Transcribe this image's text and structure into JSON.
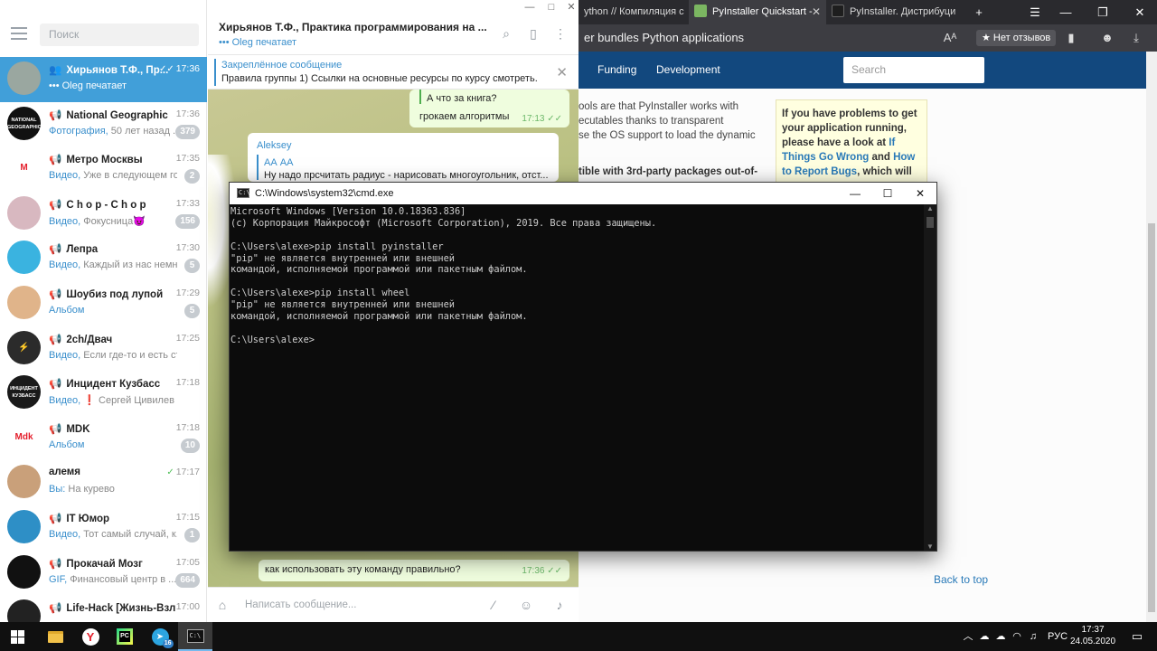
{
  "browser": {
    "tabs": [
      {
        "label": "ython // Компиляция с",
        "fav_color": "#888888"
      },
      {
        "label": "PyInstaller Quickstart - ",
        "fav_color": "#7bb661"
      },
      {
        "label": "PyInstaller. Дистрибуци",
        "fav_color": "#1e1e1e"
      }
    ],
    "new_tab": "+",
    "page_title": "er bundles Python applications",
    "reviews_label": "★ Нет отзывов",
    "nav": [
      "Funding",
      "Development"
    ],
    "search_placeholder": "Search",
    "doc_paragraph": "ools are that PyInstaller works with\necutables thanks to transparent\nse the OS support to load the dynamic",
    "doc_bold": "tible with 3rd-party packages out-of-",
    "note_text_1": "If you have problems to get your application running, please have a look at ",
    "note_link_1": "If Things Go Wrong",
    "note_text_2": " and ",
    "note_link_2": "How to Report Bugs",
    "note_text_3": ", which will",
    "back_to_top": "Back to top"
  },
  "telegram": {
    "search_placeholder": "Поиск",
    "chats": [
      {
        "name": "Хирьянов Т.Ф., Пр...",
        "type": "group",
        "time": "17:36",
        "check": "✓✓",
        "preview_kind": "",
        "preview": "••• Oleg печатает",
        "badge": "",
        "avatar_text": "",
        "avatar_color": "#9aa7a0",
        "active": true
      },
      {
        "name": "National Geographic",
        "type": "channel",
        "time": "17:36",
        "check": "",
        "preview_kind": "Фотография,",
        "preview": " 50 лет назад ...",
        "badge": "379",
        "avatar_text": "NATIONAL GEOGRAPHIC",
        "avatar_color": "#111111",
        "active": false
      },
      {
        "name": "Метро Москвы",
        "type": "channel",
        "time": "17:35",
        "check": "",
        "preview_kind": "Видео,",
        "preview": " Уже в следующем го...",
        "badge": "2",
        "avatar_text": "M",
        "avatar_color": "#ffffff",
        "active": false
      },
      {
        "name": "C h o p - C h o p",
        "type": "channel",
        "time": "17:33",
        "check": "",
        "preview_kind": "Видео,",
        "preview": " Фокусница😈",
        "badge": "156",
        "avatar_text": "",
        "avatar_color": "#d8b8c0",
        "active": false
      },
      {
        "name": "Лепра",
        "type": "channel",
        "time": "17:30",
        "check": "",
        "preview_kind": "Видео,",
        "preview": " Каждый из нас немн...",
        "badge": "5",
        "avatar_text": "",
        "avatar_color": "#3ab3e0",
        "active": false
      },
      {
        "name": "Шоубиз под лупой",
        "type": "channel",
        "time": "17:29",
        "check": "",
        "preview_kind": "Альбом",
        "preview": "",
        "badge": "5",
        "avatar_text": "",
        "avatar_color": "#e0b48a",
        "active": false
      },
      {
        "name": "2ch/Двач",
        "type": "channel",
        "time": "17:25",
        "check": "",
        "preview_kind": "Видео,",
        "preview": " Если где-то и есть стабил...",
        "badge": "",
        "avatar_text": "⚡",
        "avatar_color": "#2b2b2b",
        "active": false
      },
      {
        "name": "Инцидент Кузбасс",
        "type": "channel",
        "time": "17:18",
        "check": "",
        "preview_kind": "Видео,",
        "preview": " ❗ Сергей Цивилев обра...",
        "badge": "",
        "avatar_text": "ИНЦИДЕНТ КУЗБАСС",
        "avatar_color": "#1a1a1a",
        "active": false
      },
      {
        "name": "MDK",
        "type": "channel",
        "time": "17:18",
        "check": "",
        "preview_kind": "Альбом",
        "preview": "",
        "badge": "10",
        "avatar_text": "Mdk",
        "avatar_color": "#ffffff",
        "active": false
      },
      {
        "name": "алемя",
        "type": "user",
        "time": "17:17",
        "check": "✓",
        "preview_kind": "Вы:",
        "preview": " На курево",
        "badge": "",
        "avatar_text": "",
        "avatar_color": "#c9a07a",
        "active": false
      },
      {
        "name": "IT Юмор",
        "type": "channel",
        "time": "17:15",
        "check": "",
        "preview_kind": "Видео,",
        "preview": " Тот самый случай, к...",
        "badge": "1",
        "avatar_text": "",
        "avatar_color": "#2e8fc6",
        "active": false
      },
      {
        "name": "Прокачай Мозг",
        "type": "channel",
        "time": "17:05",
        "check": "",
        "preview_kind": "GIF,",
        "preview": " Финансовый центр в ...",
        "badge": "664",
        "avatar_text": "",
        "avatar_color": "#111111",
        "active": false
      },
      {
        "name": "Life-Hack [Жизнь-Взл...",
        "type": "channel",
        "time": "17:00",
        "check": "",
        "preview_kind": "",
        "preview": "",
        "badge": "",
        "avatar_text": "",
        "avatar_color": "#222222",
        "active": false
      }
    ],
    "header_title": "Хирьянов Т.Ф., Практика программирования на ...",
    "header_status": "••• Oleg печатает",
    "pinned_label": "Закреплённое сообщение",
    "pinned_text": "Правила группы 1) Ссылки на основные ресурсы по курсу смотреть...",
    "messages": {
      "reply_quote": "А что за книга?",
      "reply_text": "грокаем алгоритмы",
      "reply_time": "17:13",
      "reply_check": "✓✓",
      "in_author": "Aleksey",
      "in_quote_name": "АА АА",
      "in_quote_text": "Ну надо прсчитать радиус - нарисовать многоугольник, отст...",
      "last_text": "как использовать эту команду правильно?",
      "last_time": "17:36",
      "last_check": "✓✓"
    },
    "input_placeholder": "Написать сообщение..."
  },
  "cmd": {
    "title": "C:\\Windows\\system32\\cmd.exe",
    "lines": [
      "Microsoft Windows [Version 10.0.18363.836]",
      "(c) Корпорация Майкрософт (Microsoft Corporation), 2019. Все права защищены.",
      "",
      "C:\\Users\\alexe>pip install pyinstaller",
      "\"pip\" не является внутренней или внешней",
      "командой, исполняемой программой или пакетным файлом.",
      "",
      "C:\\Users\\alexe>pip install wheel",
      "\"pip\" не является внутренней или внешней",
      "командой, исполняемой программой или пакетным файлом.",
      "",
      "C:\\Users\\alexe>"
    ]
  },
  "taskbar": {
    "lang": "РУС",
    "time": "17:37",
    "date": "24.05.2020",
    "telegram_badge": "16"
  }
}
